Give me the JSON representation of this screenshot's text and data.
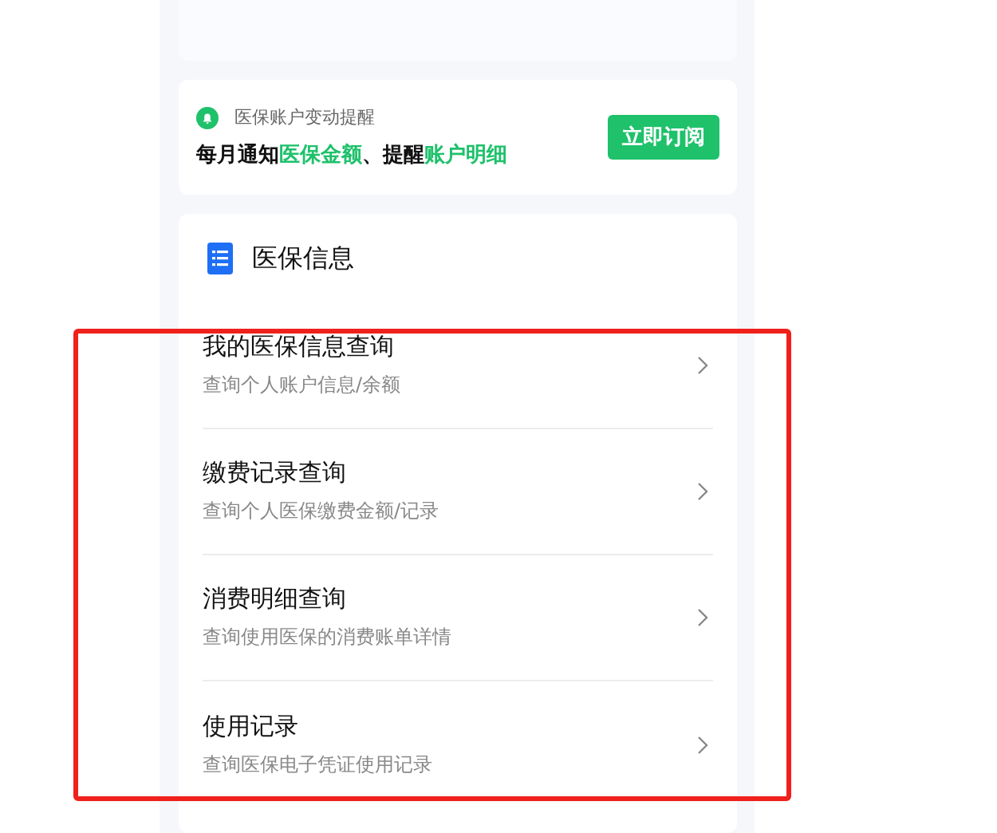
{
  "notice": {
    "title": "医保账户变动提醒",
    "message": [
      {
        "text": "每月通知",
        "highlight": false
      },
      {
        "text": "医保金额",
        "highlight": true
      },
      {
        "text": "、提醒",
        "highlight": false
      },
      {
        "text": "账户明细",
        "highlight": true
      }
    ],
    "button": "立即订阅"
  },
  "info": {
    "title": "医保信息",
    "items": [
      {
        "title": "我的医保信息查询",
        "subtitle": "查询个人账户信息/余额"
      },
      {
        "title": "缴费记录查询",
        "subtitle": "查询个人医保缴费金额/记录"
      },
      {
        "title": "消费明细查询",
        "subtitle": "查询使用医保的消费账单详情"
      },
      {
        "title": "使用记录",
        "subtitle": "查询医保电子凭证使用记录"
      }
    ]
  }
}
